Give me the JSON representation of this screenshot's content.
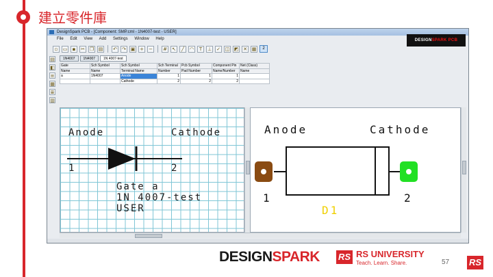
{
  "slide": {
    "title": "建立零件庫",
    "page_number": "57",
    "accent_color": "#d8262b"
  },
  "window": {
    "title": "DesignSpark PCB - [Component: SMP.cml - 1N4007-test - USER]",
    "menu": [
      "File",
      "Edit",
      "View",
      "Add",
      "Settings",
      "Window",
      "Help"
    ],
    "logo_left": "DESIGN",
    "logo_right": "SPARK PCB",
    "zoom_value": "2"
  },
  "tabs": [
    "1N4007",
    "1N4007",
    "1N 4007-test"
  ],
  "grid": {
    "headers_row1": [
      "Gate",
      "Sch Symbol",
      "Sch Symbol",
      "Sch Terminal",
      "Pcb Symbol",
      "Component Pin",
      "Net (Class)"
    ],
    "headers_row2": [
      "Name",
      "Name",
      "Terminal Name",
      "Number",
      "Pad Number",
      "Name/Number",
      "Name"
    ],
    "rows": [
      {
        "gate": "a",
        "symbol": "1N4007",
        "terminal": "Anode",
        "sch_num": "1",
        "pad_num": "1",
        "pin": "1",
        "net": ""
      },
      {
        "gate": "",
        "symbol": "",
        "terminal": "Cathode",
        "sch_num": "2",
        "pad_num": "2",
        "pin": "2",
        "net": ""
      }
    ]
  },
  "schematic": {
    "anode_label": "Anode",
    "cathode_label": "Cathode",
    "pin1": "1",
    "pin2": "2",
    "gate_label": "Gate a",
    "part_label": "1N 4007-test",
    "lib_label": "USER"
  },
  "pcb": {
    "anode_label": "Anode",
    "cathode_label": "Cathode",
    "pin1": "1",
    "pin2": "2",
    "ref_label": "D1",
    "pad1_color": "#8a4b12",
    "pad2_color": "#22e024",
    "ref_color": "#f0d000"
  },
  "footer": {
    "designspark_1": "DESIGN",
    "designspark_2": "SPARK",
    "rs_badge": "RS",
    "rs_university": "RS UNIVERSITY",
    "tagline": "Teach. Learn. Share."
  }
}
